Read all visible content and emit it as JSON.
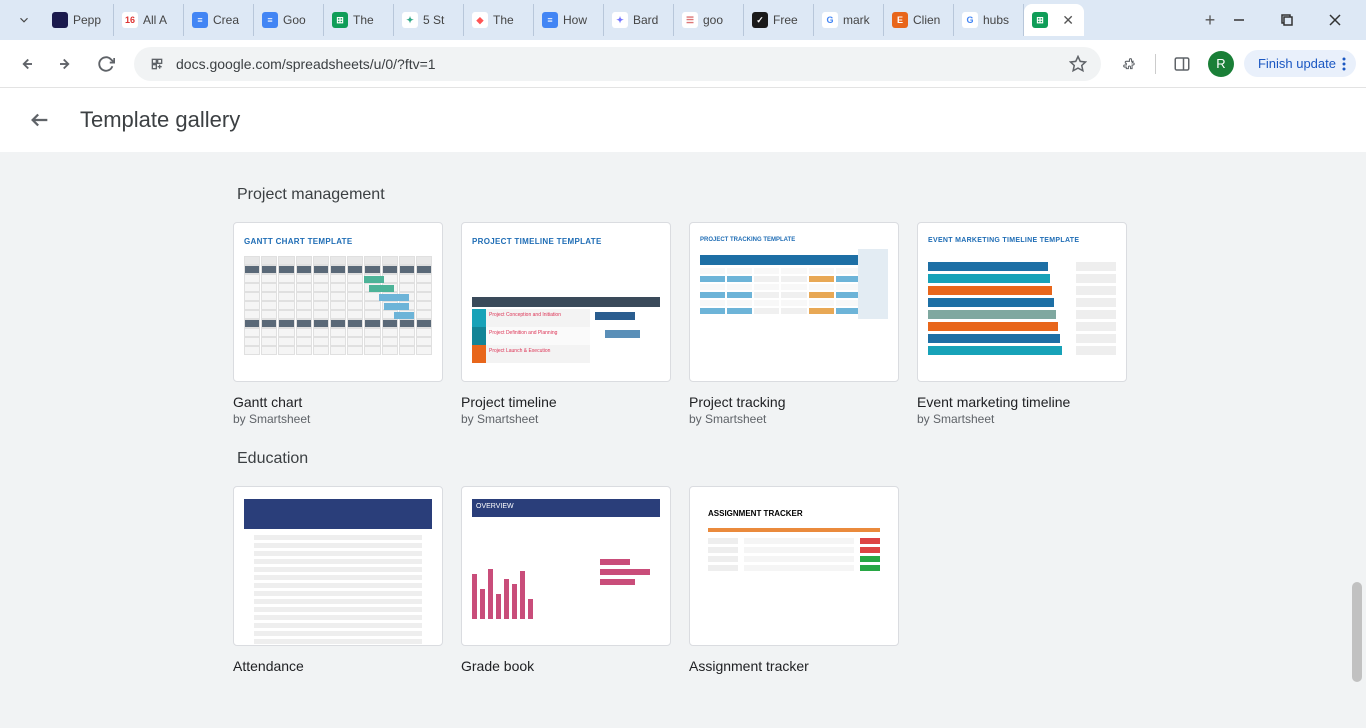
{
  "browser": {
    "tabs": [
      {
        "title": "Pepp",
        "favicon_bg": "#1a1a4d",
        "favicon_text": ""
      },
      {
        "title": "All A",
        "favicon_bg": "#fff",
        "favicon_text": "16",
        "favicon_color": "#d33"
      },
      {
        "title": "Crea",
        "favicon_bg": "#4285f4",
        "favicon_text": "≡"
      },
      {
        "title": "Goo",
        "favicon_bg": "#4285f4",
        "favicon_text": "≡"
      },
      {
        "title": "The",
        "favicon_bg": "#0f9d58",
        "favicon_text": "⊞"
      },
      {
        "title": "5 St",
        "favicon_bg": "#fff",
        "favicon_text": "✦",
        "favicon_color": "#3a8"
      },
      {
        "title": "The",
        "favicon_bg": "#fff",
        "favicon_text": "◆",
        "favicon_color": "#f55"
      },
      {
        "title": "How",
        "favicon_bg": "#4285f4",
        "favicon_text": "≡"
      },
      {
        "title": "Bard",
        "favicon_bg": "#fff",
        "favicon_text": "✦",
        "favicon_color": "#77f"
      },
      {
        "title": "goo",
        "favicon_bg": "#fff",
        "favicon_text": "☰",
        "favicon_color": "#d77"
      },
      {
        "title": "Free",
        "favicon_bg": "#1a1a1a",
        "favicon_text": "✓"
      },
      {
        "title": "mark",
        "favicon_bg": "#fff",
        "favicon_text": "G",
        "favicon_color": "#4285f4"
      },
      {
        "title": "Clien",
        "favicon_bg": "#e8661b",
        "favicon_text": "E"
      },
      {
        "title": "hubs",
        "favicon_bg": "#fff",
        "favicon_text": "G",
        "favicon_color": "#4285f4"
      },
      {
        "title": "",
        "favicon_bg": "#0f9d58",
        "favicon_text": "⊞",
        "active": true
      }
    ],
    "url": "docs.google.com/spreadsheets/u/0/?ftv=1",
    "avatar_letter": "R",
    "update_label": "Finish update"
  },
  "page": {
    "title": "Template gallery",
    "sections": [
      {
        "title": "Project management",
        "cards": [
          {
            "title": "Gantt chart",
            "sub": "by Smartsheet",
            "thumb_title": "GANTT CHART TEMPLATE",
            "kind": "gantt"
          },
          {
            "title": "Project timeline",
            "sub": "by Smartsheet",
            "thumb_title": "PROJECT TIMELINE TEMPLATE",
            "kind": "timeline"
          },
          {
            "title": "Project tracking",
            "sub": "by Smartsheet",
            "thumb_title": "PROJECT TRACKING TEMPLATE",
            "kind": "tracking"
          },
          {
            "title": "Event marketing timeline",
            "sub": "by Smartsheet",
            "thumb_title": "EVENT MARKETING TIMELINE TEMPLATE",
            "kind": "event"
          }
        ]
      },
      {
        "title": "Education",
        "cards": [
          {
            "title": "Attendance",
            "sub": "",
            "thumb_title": "",
            "kind": "attendance"
          },
          {
            "title": "Grade book",
            "sub": "",
            "thumb_title": "OVERVIEW",
            "kind": "gradebook"
          },
          {
            "title": "Assignment tracker",
            "sub": "",
            "thumb_title": "ASSIGNMENT TRACKER",
            "kind": "assignment"
          }
        ]
      }
    ]
  }
}
